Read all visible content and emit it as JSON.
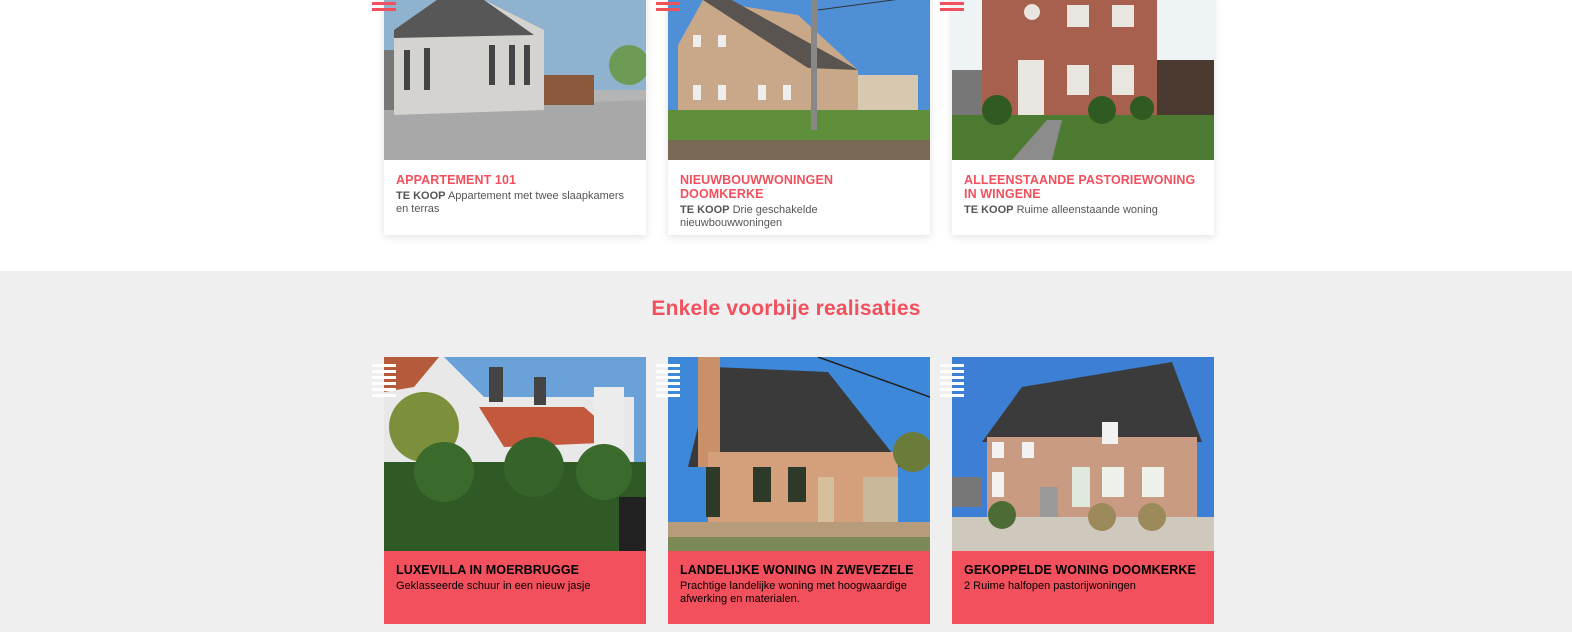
{
  "listings": [
    {
      "title": "APPARTEMENT 101",
      "tag": "TE KOOP",
      "desc": "Appartement met twee slaapkamers en terras"
    },
    {
      "title": "NIEUWBOUWWONINGEN DOOMKERKE",
      "tag": "TE KOOP",
      "desc": "Drie geschakelde nieuwbouwwoningen"
    },
    {
      "title": "ALLEENSTAANDE PASTORIEWONING IN WINGENE",
      "tag": "TE KOOP",
      "desc": "Ruime alleenstaande woning"
    }
  ],
  "realisaties": {
    "heading": "Enkele voorbije realisaties",
    "items": [
      {
        "title": "LUXEVILLA IN MOERBRUGGE",
        "desc": "Geklasseerde schuur in een nieuw jasje"
      },
      {
        "title": "LANDELIJKE WONING IN ZWEVEZELE",
        "desc": "Prachtige landelijke woning met hoogwaardige afwerking en materialen."
      },
      {
        "title": "GEKOPPELDE WONING DOOMKERKE",
        "desc": "2 Ruime halfopen pastorijwoningen"
      }
    ]
  },
  "colors": {
    "accent": "#f2505d",
    "section_bg": "#efefef"
  },
  "icons": {
    "menu": "menu-icon"
  }
}
